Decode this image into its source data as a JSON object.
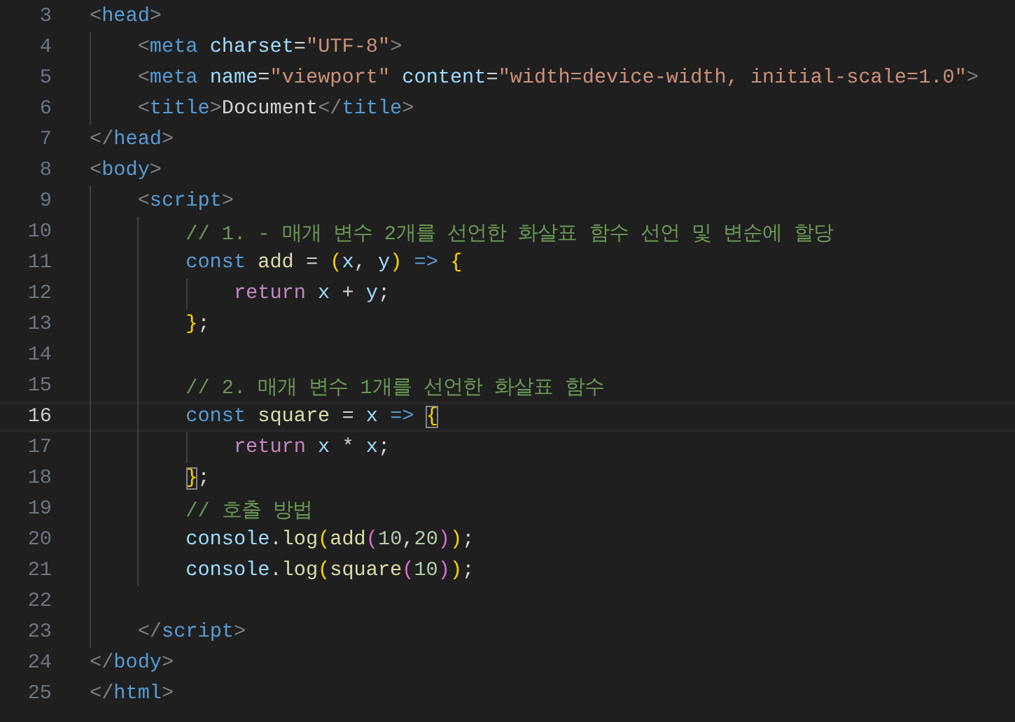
{
  "editor": {
    "lines": [
      {
        "number": "3",
        "current": false,
        "tokens": [
          {
            "text": "<",
            "kind": "angle"
          },
          {
            "text": "head",
            "kind": "tag"
          },
          {
            "text": ">",
            "kind": "angle"
          }
        ]
      },
      {
        "number": "4",
        "current": false,
        "tokens": [
          {
            "text": "    <",
            "kind": "angle"
          },
          {
            "text": "meta",
            "kind": "tag"
          },
          {
            "text": " charset",
            "kind": "attr"
          },
          {
            "text": "=",
            "kind": "plain"
          },
          {
            "text": "\"UTF-8\"",
            "kind": "string"
          },
          {
            "text": ">",
            "kind": "angle"
          }
        ]
      },
      {
        "number": "5",
        "current": false,
        "tokens": [
          {
            "text": "    <",
            "kind": "angle"
          },
          {
            "text": "meta",
            "kind": "tag"
          },
          {
            "text": " name",
            "kind": "attr"
          },
          {
            "text": "=",
            "kind": "plain"
          },
          {
            "text": "\"viewport\"",
            "kind": "string"
          },
          {
            "text": " content",
            "kind": "attr"
          },
          {
            "text": "=",
            "kind": "plain"
          },
          {
            "text": "\"width=device-width, initial-scale=1.0\"",
            "kind": "string"
          },
          {
            "text": ">",
            "kind": "angle"
          }
        ]
      },
      {
        "number": "6",
        "current": false,
        "tokens": [
          {
            "text": "    <",
            "kind": "angle"
          },
          {
            "text": "title",
            "kind": "tag"
          },
          {
            "text": ">",
            "kind": "angle"
          },
          {
            "text": "Document",
            "kind": "plain"
          },
          {
            "text": "</",
            "kind": "angle"
          },
          {
            "text": "title",
            "kind": "tag"
          },
          {
            "text": ">",
            "kind": "angle"
          }
        ]
      },
      {
        "number": "7",
        "current": false,
        "tokens": [
          {
            "text": "</",
            "kind": "angle"
          },
          {
            "text": "head",
            "kind": "tag"
          },
          {
            "text": ">",
            "kind": "angle"
          }
        ]
      },
      {
        "number": "8",
        "current": false,
        "tokens": [
          {
            "text": "<",
            "kind": "angle"
          },
          {
            "text": "body",
            "kind": "tag"
          },
          {
            "text": ">",
            "kind": "angle"
          }
        ]
      },
      {
        "number": "9",
        "current": false,
        "tokens": [
          {
            "text": "    <",
            "kind": "angle"
          },
          {
            "text": "script",
            "kind": "tag"
          },
          {
            "text": ">",
            "kind": "angle"
          }
        ]
      },
      {
        "number": "10",
        "current": false,
        "tokens": [
          {
            "text": "        // 1. - 매개 변수 2개를 선언한 화살표 함수 선언 및 변순에 할당",
            "kind": "comment"
          }
        ]
      },
      {
        "number": "11",
        "current": false,
        "tokens": [
          {
            "text": "        const",
            "kind": "keyword"
          },
          {
            "text": " add",
            "kind": "function"
          },
          {
            "text": " = ",
            "kind": "plain"
          },
          {
            "text": "(",
            "kind": "bracket1"
          },
          {
            "text": "x",
            "kind": "variable"
          },
          {
            "text": ", ",
            "kind": "plain"
          },
          {
            "text": "y",
            "kind": "variable"
          },
          {
            "text": ")",
            "kind": "bracket1"
          },
          {
            "text": " =>",
            "kind": "keyword"
          },
          {
            "text": " {",
            "kind": "bracket1"
          }
        ]
      },
      {
        "number": "12",
        "current": false,
        "tokens": [
          {
            "text": "            return",
            "kind": "control"
          },
          {
            "text": " x",
            "kind": "variable"
          },
          {
            "text": " + ",
            "kind": "plain"
          },
          {
            "text": "y",
            "kind": "variable"
          },
          {
            "text": ";",
            "kind": "plain"
          }
        ]
      },
      {
        "number": "13",
        "current": false,
        "tokens": [
          {
            "text": "        }",
            "kind": "bracket1"
          },
          {
            "text": ";",
            "kind": "plain"
          }
        ]
      },
      {
        "number": "14",
        "current": false
      },
      {
        "number": "15",
        "current": false,
        "tokens": [
          {
            "text": "        // 2. 매개 변수 1개를 선언한 화살표 함수",
            "kind": "comment"
          }
        ]
      },
      {
        "number": "16",
        "current": true,
        "tokens": [
          {
            "text": "        const",
            "kind": "keyword"
          },
          {
            "text": " square",
            "kind": "function"
          },
          {
            "text": " = ",
            "kind": "plain"
          },
          {
            "text": "x",
            "kind": "variable"
          },
          {
            "text": " => ",
            "kind": "keyword"
          },
          {
            "text": "{",
            "kind": "bracket1",
            "matched": true
          }
        ]
      },
      {
        "number": "17",
        "current": false,
        "tokens": [
          {
            "text": "            return",
            "kind": "control"
          },
          {
            "text": " x",
            "kind": "variable"
          },
          {
            "text": " * ",
            "kind": "plain"
          },
          {
            "text": "x",
            "kind": "variable"
          },
          {
            "text": ";",
            "kind": "plain"
          }
        ]
      },
      {
        "number": "18",
        "current": false,
        "tokens": [
          {
            "text": "        }",
            "kind": "bracket1",
            "matched": true
          },
          {
            "text": ";",
            "kind": "plain"
          }
        ]
      },
      {
        "number": "19",
        "current": false,
        "tokens": [
          {
            "text": "        // 호출 방법",
            "kind": "comment"
          }
        ]
      },
      {
        "number": "20",
        "current": false,
        "tokens": [
          {
            "text": "        console",
            "kind": "variable"
          },
          {
            "text": ".",
            "kind": "plain"
          },
          {
            "text": "log",
            "kind": "function"
          },
          {
            "text": "(",
            "kind": "bracket1"
          },
          {
            "text": "add",
            "kind": "function"
          },
          {
            "text": "(",
            "kind": "bracket2"
          },
          {
            "text": "10",
            "kind": "number"
          },
          {
            "text": ",",
            "kind": "plain"
          },
          {
            "text": "20",
            "kind": "number"
          },
          {
            "text": ")",
            "kind": "bracket2"
          },
          {
            "text": ")",
            "kind": "bracket1"
          },
          {
            "text": ";",
            "kind": "plain"
          }
        ]
      },
      {
        "number": "21",
        "current": false,
        "tokens": [
          {
            "text": "        console",
            "kind": "variable"
          },
          {
            "text": ".",
            "kind": "plain"
          },
          {
            "text": "log",
            "kind": "function"
          },
          {
            "text": "(",
            "kind": "bracket1"
          },
          {
            "text": "square",
            "kind": "function"
          },
          {
            "text": "(",
            "kind": "bracket2"
          },
          {
            "text": "10",
            "kind": "number"
          },
          {
            "text": ")",
            "kind": "bracket2"
          },
          {
            "text": ")",
            "kind": "bracket1"
          },
          {
            "text": ";",
            "kind": "plain"
          }
        ]
      },
      {
        "number": "22",
        "current": false
      },
      {
        "number": "23",
        "current": false,
        "tokens": [
          {
            "text": "    </",
            "kind": "angle"
          },
          {
            "text": "script",
            "kind": "tag"
          },
          {
            "text": ">",
            "kind": "angle"
          }
        ]
      },
      {
        "number": "24",
        "current": false,
        "tokens": [
          {
            "text": "</",
            "kind": "angle"
          },
          {
            "text": "body",
            "kind": "tag"
          },
          {
            "text": ">",
            "kind": "angle"
          }
        ]
      },
      {
        "number": "25",
        "current": false,
        "tokens": [
          {
            "text": "</",
            "kind": "angle"
          },
          {
            "text": "html",
            "kind": "tag"
          },
          {
            "text": ">",
            "kind": "angle"
          }
        ]
      }
    ]
  }
}
